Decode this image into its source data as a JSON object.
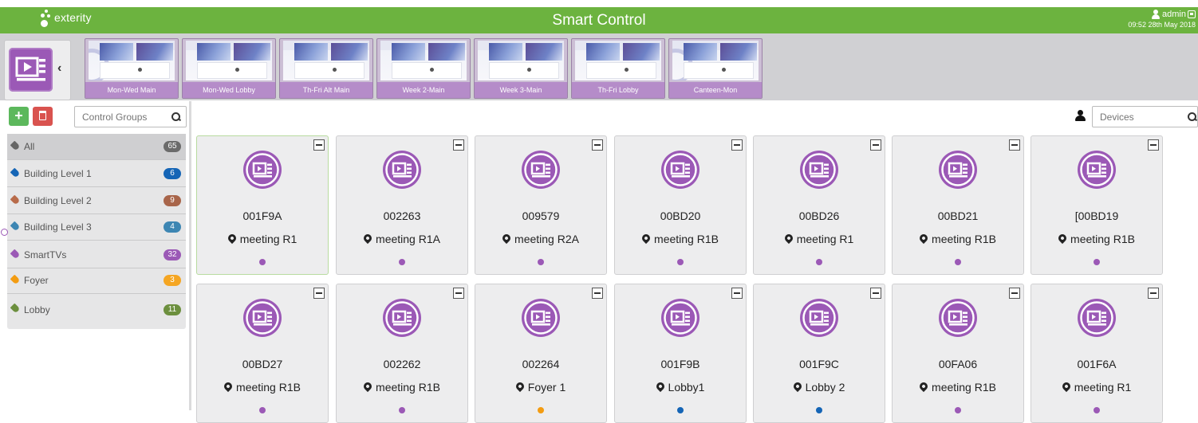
{
  "header": {
    "logo_text": "exterity",
    "title": "Smart Control",
    "user": "admin",
    "datetime": "09:52  28th May 2018",
    "bar_color": "#6cb33f"
  },
  "schedule_strip": {
    "icon": "media-player-icon",
    "collapse_icon": "chevron-left-icon",
    "items": [
      {
        "label": "Mon-Wed Main"
      },
      {
        "label": "Mon-Wed Lobby"
      },
      {
        "label": "Th-Fri Alt Main"
      },
      {
        "label": "Week 2-Main"
      },
      {
        "label": "Week 3-Main"
      },
      {
        "label": "Th-Fri Lobby"
      },
      {
        "label": "Canteen-Mon"
      }
    ]
  },
  "left_panel": {
    "add_label": "+",
    "group_search_placeholder": "Control Groups",
    "groups": [
      {
        "label": "All",
        "count": "65",
        "color": "#666666",
        "badge_color": "#6b6b6b"
      },
      {
        "label": "Building Level 1",
        "count": "6",
        "color": "#1565b6",
        "badge_color": "#1565b6"
      },
      {
        "label": "Building Level 2",
        "count": "9",
        "color": "#b86b4a",
        "badge_color": "#a8654a"
      },
      {
        "label": "Building Level 3",
        "count": "4",
        "color": "#3d86b3",
        "badge_color": "#3d86b3"
      },
      {
        "label": "SmartTVs",
        "count": "32",
        "color": "#9b59b6",
        "badge_color": "#9b59b6"
      },
      {
        "label": "Foyer",
        "count": "3",
        "color": "#f39c12",
        "badge_color": "#f5a623"
      },
      {
        "label": "Lobby",
        "count": "11",
        "color": "#6c8f3e",
        "badge_color": "#6c8f3e"
      }
    ]
  },
  "devices_search_placeholder": "Devices",
  "devices": [
    {
      "id": "001F9A",
      "location": "meeting R1",
      "dot": "#9b59b6"
    },
    {
      "id": "002263",
      "location": "meeting  R1A",
      "dot": "#9b59b6"
    },
    {
      "id": "009579",
      "location": "meeting R2A",
      "dot": "#9b59b6"
    },
    {
      "id": "00BD20",
      "location": "meeting  R1B",
      "dot": "#9b59b6"
    },
    {
      "id": "00BD26",
      "location": "meeting  R1",
      "dot": "#9b59b6"
    },
    {
      "id": "00BD21",
      "location": "meeting  R1B",
      "dot": "#9b59b6"
    },
    {
      "id": "[00BD19",
      "location": "meeting  R1B",
      "dot": "#9b59b6"
    },
    {
      "id": "00BD27",
      "location": "meeting  R1B",
      "dot": "#9b59b6"
    },
    {
      "id": "002262",
      "location": "meeting  R1B",
      "dot": "#9b59b6"
    },
    {
      "id": "002264",
      "location": "Foyer 1",
      "dot": "#f39c12"
    },
    {
      "id": "001F9B",
      "location": "Lobby1",
      "dot": "#1565b6"
    },
    {
      "id": "001F9C",
      "location": "Lobby 2",
      "dot": "#1565b6"
    },
    {
      "id": "00FA06",
      "location": "meeting  R1B",
      "dot": "#9b59b6"
    },
    {
      "id": "001F6A",
      "location": "meeting R1",
      "dot": "#9b59b6"
    }
  ],
  "accent_color": "#9b59b6"
}
